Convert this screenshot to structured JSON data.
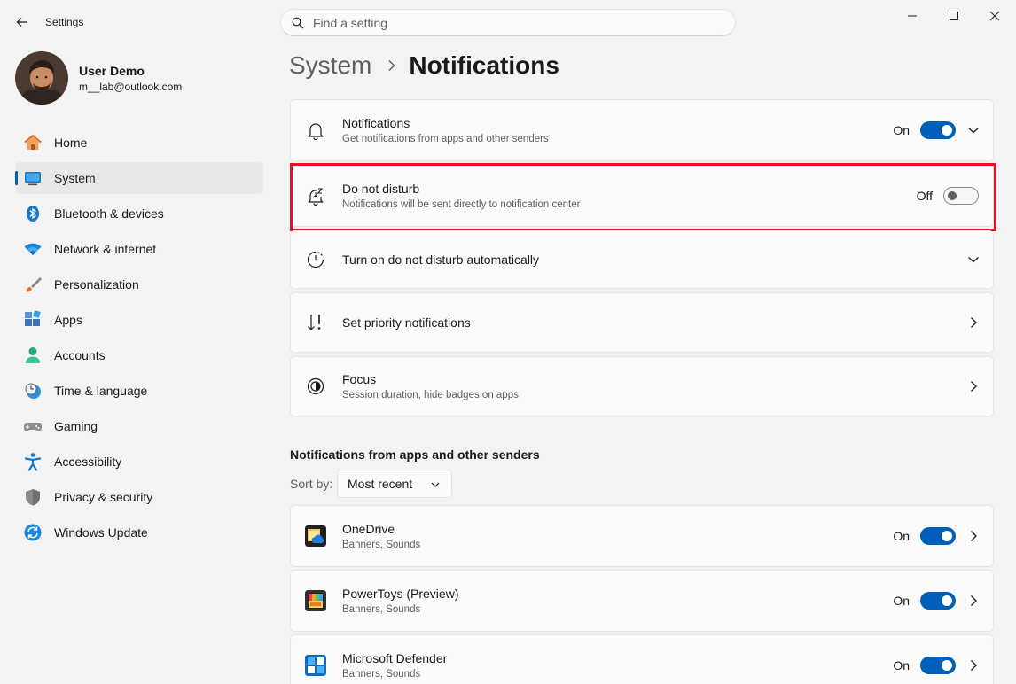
{
  "app": {
    "title": "Settings"
  },
  "search": {
    "placeholder": "Find a setting"
  },
  "profile": {
    "name": "User Demo",
    "email": "m__lab@outlook.com"
  },
  "nav": {
    "items": [
      {
        "label": "Home",
        "icon": "home-icon"
      },
      {
        "label": "System",
        "icon": "system-icon",
        "active": true
      },
      {
        "label": "Bluetooth & devices",
        "icon": "bluetooth-icon"
      },
      {
        "label": "Network & internet",
        "icon": "wifi-icon"
      },
      {
        "label": "Personalization",
        "icon": "brush-icon"
      },
      {
        "label": "Apps",
        "icon": "apps-icon"
      },
      {
        "label": "Accounts",
        "icon": "account-icon"
      },
      {
        "label": "Time & language",
        "icon": "clock-globe-icon"
      },
      {
        "label": "Gaming",
        "icon": "gamepad-icon"
      },
      {
        "label": "Accessibility",
        "icon": "accessibility-icon"
      },
      {
        "label": "Privacy & security",
        "icon": "shield-icon"
      },
      {
        "label": "Windows Update",
        "icon": "update-icon"
      }
    ]
  },
  "breadcrumb": {
    "parent": "System",
    "current": "Notifications"
  },
  "settings": {
    "notifications": {
      "title": "Notifications",
      "subtitle": "Get notifications from apps and other senders",
      "state": "On",
      "on": true
    },
    "dnd": {
      "title": "Do not disturb",
      "subtitle": "Notifications will be sent directly to notification center",
      "state": "Off",
      "on": false
    },
    "dnd_auto": {
      "title": "Turn on do not disturb automatically"
    },
    "priority": {
      "title": "Set priority notifications"
    },
    "focus": {
      "title": "Focus",
      "subtitle": "Session duration, hide badges on apps"
    }
  },
  "senders": {
    "title": "Notifications from apps and other senders",
    "sort_label": "Sort by:",
    "sort_value": "Most recent",
    "apps": [
      {
        "name": "OneDrive",
        "detail": "Banners, Sounds",
        "state": "On"
      },
      {
        "name": "PowerToys (Preview)",
        "detail": "Banners, Sounds",
        "state": "On"
      },
      {
        "name": "Microsoft Defender",
        "detail": "Banners, Sounds",
        "state": "On"
      }
    ]
  },
  "colors": {
    "accent": "#005fb8",
    "highlight": "#e81123"
  }
}
